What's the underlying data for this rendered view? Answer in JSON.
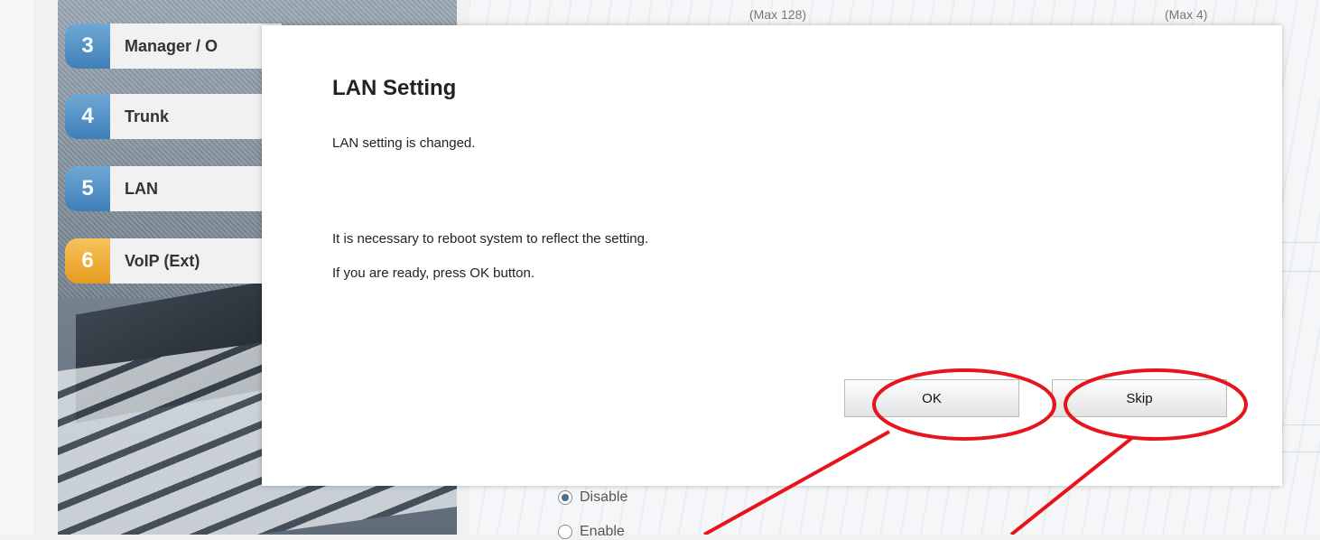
{
  "background": {
    "max_labels": [
      "(Max 128)",
      "(Max 4)"
    ],
    "radio_options": [
      {
        "label": "Disable",
        "checked": true
      },
      {
        "label": "Enable",
        "checked": false
      }
    ]
  },
  "sidebar": {
    "steps": [
      {
        "number": "3",
        "label": "Manager / O",
        "accent": "#4f8fc6"
      },
      {
        "number": "4",
        "label": "Trunk",
        "accent": "#4f8fc6"
      },
      {
        "number": "5",
        "label": "LAN",
        "accent": "#4f8fc6"
      },
      {
        "number": "6",
        "label": "VoIP (Ext)",
        "accent": "#f0ad32"
      }
    ]
  },
  "dialog": {
    "title": "LAN Setting",
    "line1": "LAN setting is changed.",
    "line2": "It is necessary to reboot system to reflect the setting.",
    "line3": "If you are ready, press OK button.",
    "ok_label": "OK",
    "skip_label": "Skip"
  },
  "annotation_color": "#e8141c"
}
